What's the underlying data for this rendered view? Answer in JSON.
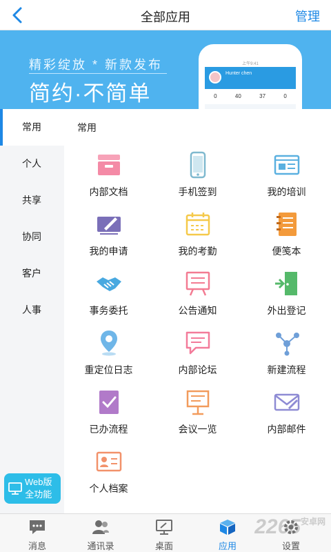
{
  "header": {
    "title": "全部应用",
    "manage_label": "管理"
  },
  "banner": {
    "line1": "精彩绽放 * 新款发布",
    "line2": "简约·不简单",
    "phone": {
      "status": "上午9:41",
      "name": "Hunter chen",
      "stats": [
        "0",
        "40",
        "37",
        "0"
      ]
    }
  },
  "sidebar": {
    "items": [
      {
        "label": "常用",
        "active": true
      },
      {
        "label": "个人"
      },
      {
        "label": "共享"
      },
      {
        "label": "协同"
      },
      {
        "label": "客户"
      },
      {
        "label": "人事"
      }
    ]
  },
  "section_title": "常用",
  "apps": [
    {
      "label": "内部文档",
      "icon": "archive-box-icon"
    },
    {
      "label": "手机签到",
      "icon": "mobile-phone-icon"
    },
    {
      "label": "我的培训",
      "icon": "training-screen-icon"
    },
    {
      "label": "我的申请",
      "icon": "pen-application-icon"
    },
    {
      "label": "我的考勤",
      "icon": "calendar-icon"
    },
    {
      "label": "便笺本",
      "icon": "notebook-icon"
    },
    {
      "label": "事务委托",
      "icon": "handshake-icon"
    },
    {
      "label": "公告通知",
      "icon": "announcement-board-icon"
    },
    {
      "label": "外出登记",
      "icon": "exit-door-icon"
    },
    {
      "label": "重定位日志",
      "icon": "location-pin-icon"
    },
    {
      "label": "内部论坛",
      "icon": "chat-bubble-icon"
    },
    {
      "label": "新建流程",
      "icon": "workflow-nodes-icon"
    },
    {
      "label": "已办流程",
      "icon": "completed-doc-icon"
    },
    {
      "label": "会议一览",
      "icon": "meeting-board-icon"
    },
    {
      "label": "内部邮件",
      "icon": "mail-icon"
    },
    {
      "label": "个人档案",
      "icon": "id-card-icon"
    }
  ],
  "web_button": {
    "line1": "Web版",
    "line2": "全功能"
  },
  "tabbar": {
    "tabs": [
      {
        "label": "消息",
        "icon": "message-icon"
      },
      {
        "label": "通讯录",
        "icon": "contacts-icon"
      },
      {
        "label": "桌面",
        "icon": "desktop-icon"
      },
      {
        "label": "应用",
        "icon": "apps-cube-icon",
        "active": true
      },
      {
        "label": "设置",
        "icon": "settings-icon"
      }
    ]
  },
  "watermark": {
    "text": "2265",
    "sub": "安卓网"
  },
  "colors": {
    "accent": "#1e88e5",
    "banner": "#4fb3ef",
    "web_button": "#2dbde8"
  }
}
